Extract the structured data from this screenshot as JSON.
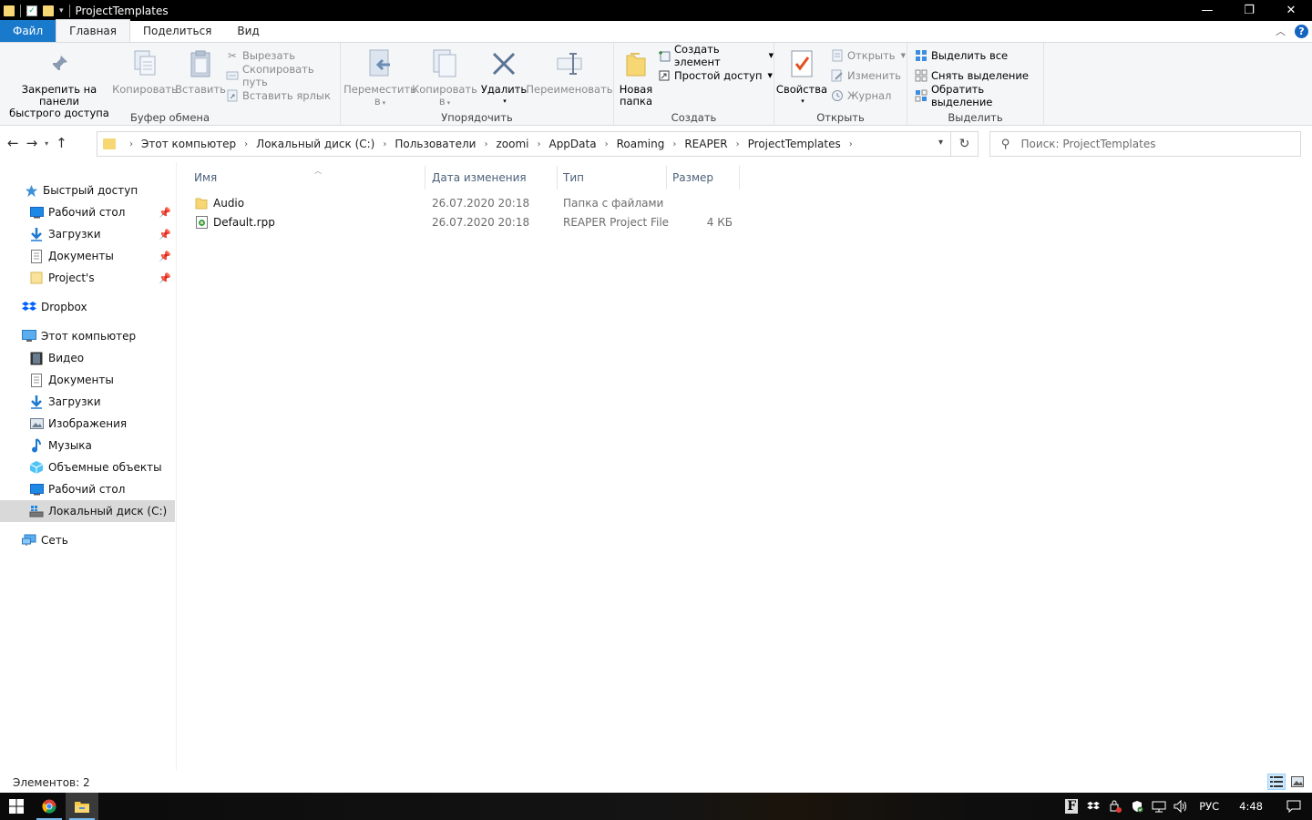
{
  "window": {
    "title": "ProjectTemplates",
    "minimize": "—",
    "maximize": "❐",
    "close": "✕"
  },
  "tabs": {
    "file": "Файл",
    "home": "Главная",
    "share": "Поделиться",
    "view": "Вид"
  },
  "ribbon": {
    "clipboard": {
      "label": "Буфер обмена",
      "pin": "Закрепить на панели быстрого доступа",
      "pin_line1": "Закрепить на панели",
      "pin_line2": "быстрого доступа",
      "copy": "Копировать",
      "paste": "Вставить",
      "cut": "Вырезать",
      "copy_path": "Скопировать путь",
      "paste_shortcut": "Вставить ярлык"
    },
    "organize": {
      "label": "Упорядочить",
      "move_line1": "Переместить",
      "move_line2": "в",
      "copy_line1": "Копировать",
      "copy_line2": "в",
      "delete": "Удалить",
      "rename": "Переименовать"
    },
    "new": {
      "label": "Создать",
      "new_folder_line1": "Новая",
      "new_folder_line2": "папка",
      "new_item": "Создать элемент",
      "easy_access": "Простой доступ"
    },
    "open": {
      "label": "Открыть",
      "properties": "Свойства",
      "open": "Открыть",
      "edit": "Изменить",
      "history": "Журнал"
    },
    "select": {
      "label": "Выделить",
      "select_all": "Выделить все",
      "select_none": "Снять выделение",
      "invert": "Обратить выделение"
    }
  },
  "address": {
    "crumbs": [
      "Этот компьютер",
      "Локальный диск (C:)",
      "Пользователи",
      "zoomi",
      "AppData",
      "Roaming",
      "REAPER",
      "ProjectTemplates"
    ],
    "search_placeholder": "Поиск: ProjectTemplates"
  },
  "sidebar": {
    "quick_access": "Быстрый доступ",
    "quick_items": [
      "Рабочий стол",
      "Загрузки",
      "Документы",
      "Project's"
    ],
    "dropbox": "Dropbox",
    "this_pc": "Этот компьютер",
    "pc_items": [
      "Видео",
      "Документы",
      "Загрузки",
      "Изображения",
      "Музыка",
      "Объемные объекты",
      "Рабочий стол",
      "Локальный диск (C:)"
    ],
    "network": "Сеть"
  },
  "columns": {
    "name": "Имя",
    "date": "Дата изменения",
    "type": "Тип",
    "size": "Размер"
  },
  "files": [
    {
      "name": "Audio",
      "date": "26.07.2020 20:18",
      "type": "Папка с файлами",
      "size": ""
    },
    {
      "name": "Default.rpp",
      "date": "26.07.2020 20:18",
      "type": "REAPER Project File",
      "size": "4 КБ"
    }
  ],
  "status": {
    "count": "Элементов: 2"
  },
  "taskbar": {
    "lang": "РУС",
    "time": "4:48"
  },
  "colors": {
    "file_tab": "#1979ca",
    "folder": "#f7d774",
    "selection": "#d9d9d9",
    "column_header": "#4c607a"
  }
}
